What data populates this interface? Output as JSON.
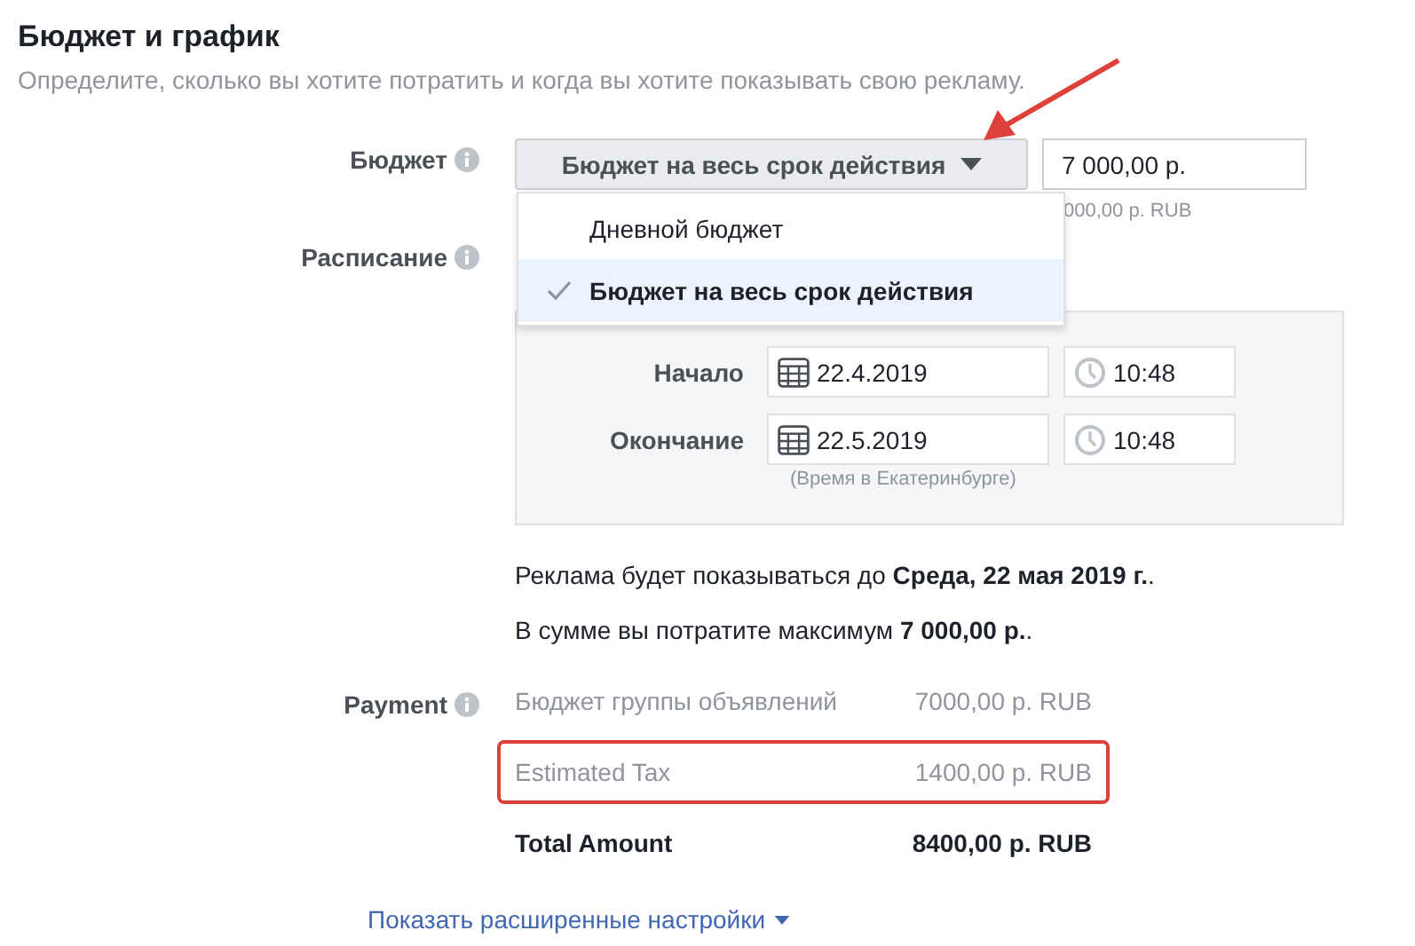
{
  "section": {
    "title": "Бюджет и график",
    "subtitle": "Определите, сколько вы хотите потратить и когда вы хотите показывать свою рекламу."
  },
  "budget": {
    "label": "Бюджет",
    "type_button": "Бюджет на весь срок действия",
    "amount": "7 000,00 р.",
    "hint": "000,00 р. RUB",
    "menu": [
      {
        "label": "Дневной бюджет",
        "selected": false
      },
      {
        "label": "Бюджет на весь срок действия",
        "selected": true
      }
    ]
  },
  "schedule": {
    "label": "Расписание",
    "rows": [
      {
        "label": "Начало",
        "date": "22.4.2019",
        "time": "10:48"
      },
      {
        "label": "Окончание",
        "date": "22.5.2019",
        "time": "10:48"
      }
    ],
    "timezone_note": "(Время в Екатеринбурге)"
  },
  "summary": [
    "Реклама будет показываться до **Среда, 22 мая 2019 г.**.",
    "В сумме вы потратите максимум **7 000,00 р.**."
  ],
  "payment": {
    "label": "Payment",
    "rows": [
      {
        "kind": "normal",
        "label": "Бюджет группы объявлений",
        "value": "7000,00 р. RUB",
        "highlighted": false
      },
      {
        "kind": "normal",
        "label": "Estimated Tax",
        "value": "1400,00 р. RUB",
        "highlighted": true
      },
      {
        "kind": "total",
        "label": "Total Amount",
        "value": "8400,00 р. RUB",
        "highlighted": false
      }
    ]
  },
  "advanced_link": "Показать расширенные настройки",
  "annotation_arrow": true
}
